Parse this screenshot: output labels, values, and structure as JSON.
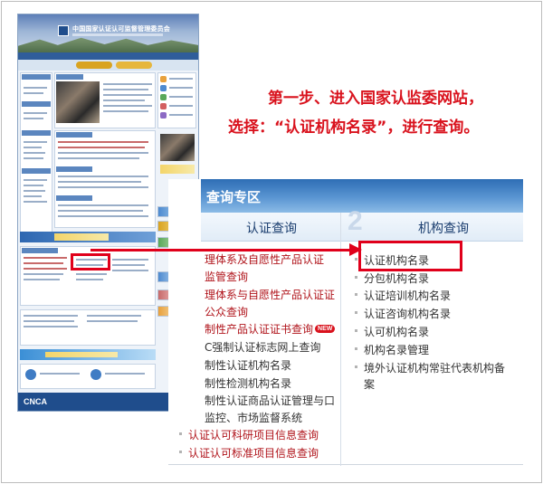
{
  "instructions": {
    "line1": "第一步、进入国家认监委网站，",
    "line2": "选择：“认证机构名录”，进行查询。"
  },
  "mini_site": {
    "header_title": "中国国家认证认可监督管理委员会",
    "footer_logo": "CNCA"
  },
  "panel": {
    "title": "查询专区",
    "tab_left": "认证查询",
    "tab_right": "机构查询",
    "tab_number": "2",
    "left_items": [
      "理体系及自愿性产品认证",
      "监管查询",
      "理体系与自愿性产品认证证",
      "公众查询",
      "制性产品认证证书查询",
      "C强制认证标志网上查询",
      "制性认证机构名录",
      "制性检测机构名录",
      "制性认证商品认证管理与口",
      "监控、市场监督系统",
      "认证认可科研项目信息查询",
      "认证认可标准项目信息查询"
    ],
    "new_badge": "NEW",
    "right_items": [
      "认证机构名录",
      "分包机构名录",
      "认证培训机构名录",
      "认证咨询机构名录",
      "认可机构名录",
      "机构名录管理",
      "境外认证机构常驻代表机构备",
      "案"
    ]
  },
  "colors": {
    "accent_red": "#e0001b",
    "header_blue": "#2e6eb5",
    "link_dark_red": "#b0141b"
  }
}
